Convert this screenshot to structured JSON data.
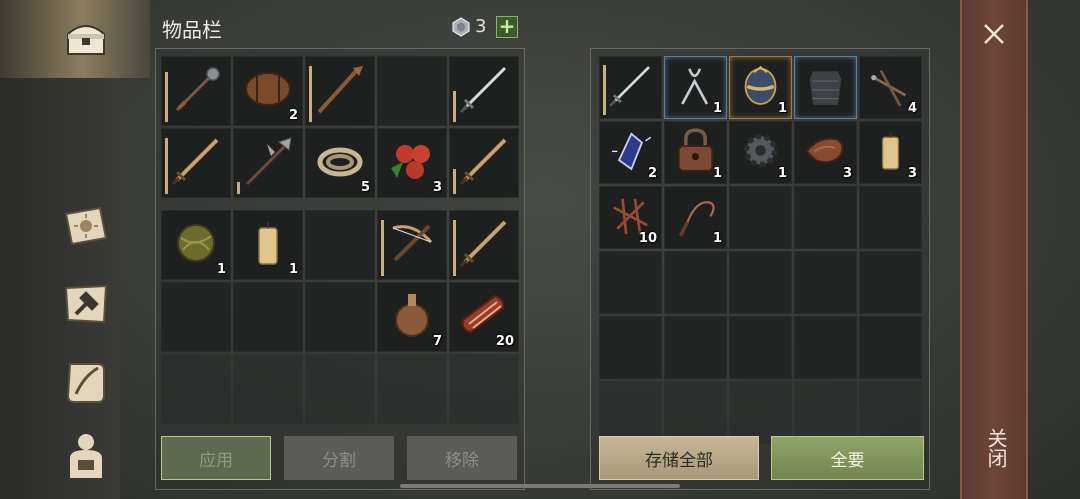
{
  "header": {
    "title": "物品栏",
    "gem_count": "3",
    "plus_label": "+"
  },
  "inventory_rows": [
    [
      {
        "icon": "mace-icon",
        "count": "",
        "dura": 0.8
      },
      {
        "icon": "barrel-icon",
        "count": "2"
      },
      {
        "icon": "torch-stick-icon",
        "count": "",
        "dura": 0.9
      },
      {
        "icon": "",
        "count": ""
      },
      {
        "icon": "sword-icon",
        "count": "",
        "dura": 0.5
      }
    ],
    [
      {
        "icon": "wooden-sword-icon",
        "count": "",
        "dura": 0.9
      },
      {
        "icon": "halberd-icon",
        "count": "",
        "dura": 0.2
      },
      {
        "icon": "rope-icon",
        "count": "5"
      },
      {
        "icon": "berries-icon",
        "count": "3"
      },
      {
        "icon": "wooden-sword-icon",
        "count": "",
        "dura": 0.4
      }
    ]
  ],
  "backpack_rows": [
    [
      {
        "icon": "fiber-ball-icon",
        "count": "1"
      },
      {
        "icon": "candle-icon",
        "count": "1"
      },
      {
        "icon": "",
        "count": ""
      },
      {
        "icon": "crossbow-icon",
        "count": "",
        "dura": 0.9
      },
      {
        "icon": "wooden-sword-icon",
        "count": "",
        "dura": 0.9
      }
    ],
    [
      {
        "icon": "",
        "count": ""
      },
      {
        "icon": "",
        "count": ""
      },
      {
        "icon": "",
        "count": ""
      },
      {
        "icon": "flask-icon",
        "count": "7"
      },
      {
        "icon": "meat-icon",
        "count": "20"
      }
    ]
  ],
  "storage_rows": [
    [
      {
        "icon": "sword-icon",
        "count": "",
        "dura": 0.9
      },
      {
        "icon": "pliers-icon",
        "count": "1",
        "sel": "blue"
      },
      {
        "icon": "egg-icon",
        "count": "1",
        "sel": "orange"
      },
      {
        "icon": "armor-icon",
        "count": "",
        "sel": "blue"
      },
      {
        "icon": "nails-icon",
        "count": "4"
      }
    ],
    [
      {
        "icon": "crystal-icon",
        "count": "2"
      },
      {
        "icon": "lock-icon",
        "count": "1"
      },
      {
        "icon": "gear-icon",
        "count": "1"
      },
      {
        "icon": "leather-icon",
        "count": "3"
      },
      {
        "icon": "candle-icon",
        "count": "3"
      }
    ],
    [
      {
        "icon": "scrap-icon",
        "count": "10"
      },
      {
        "icon": "whip-icon",
        "count": "1"
      },
      {
        "icon": "",
        "count": ""
      },
      {
        "icon": "",
        "count": ""
      },
      {
        "icon": "",
        "count": ""
      }
    ],
    [
      {
        "icon": "",
        "count": ""
      },
      {
        "icon": "",
        "count": ""
      },
      {
        "icon": "",
        "count": ""
      },
      {
        "icon": "",
        "count": ""
      },
      {
        "icon": "",
        "count": ""
      }
    ],
    [
      {
        "icon": "",
        "count": ""
      },
      {
        "icon": "",
        "count": ""
      },
      {
        "icon": "",
        "count": ""
      },
      {
        "icon": "",
        "count": ""
      },
      {
        "icon": "",
        "count": ""
      }
    ]
  ],
  "buttons": {
    "apply": "应用",
    "split": "分割",
    "remove": "移除",
    "store_all": "存储全部",
    "take_all": "全要"
  },
  "close_label": "关闭",
  "sidebar": [
    {
      "icon": "chest-icon"
    },
    {
      "icon": "sun-book-icon"
    },
    {
      "icon": "map-hammer-icon"
    },
    {
      "icon": "scroll-quill-icon"
    },
    {
      "icon": "character-icon"
    }
  ],
  "colors": {
    "accent_green": "#7f9559",
    "accent_tan": "#b8a888",
    "close_panel": "#6e4538"
  }
}
